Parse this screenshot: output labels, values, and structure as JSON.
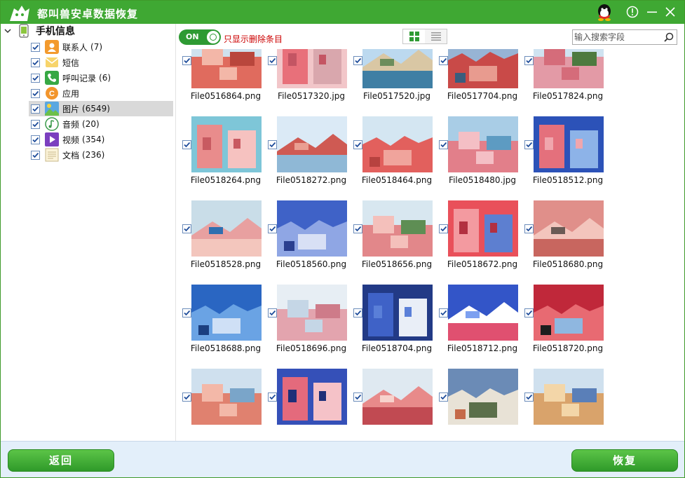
{
  "app": {
    "title": "都叫兽安卓数据恢复",
    "brand_color": "#3fa833"
  },
  "sidebar": {
    "root_label": "手机信息",
    "categories": [
      {
        "name": "联系人",
        "count": "(7)",
        "icon": "contacts-icon",
        "checked": true,
        "selected": false
      },
      {
        "name": "短信",
        "count": "",
        "icon": "sms-icon",
        "checked": true,
        "selected": false
      },
      {
        "name": "呼叫记录",
        "count": "(6)",
        "icon": "call-log-icon",
        "checked": true,
        "selected": false
      },
      {
        "name": "应用",
        "count": "",
        "icon": "apps-icon",
        "checked": true,
        "selected": false
      },
      {
        "name": "图片",
        "count": "(6549)",
        "icon": "photos-icon",
        "checked": true,
        "selected": true
      },
      {
        "name": "音频",
        "count": "(20)",
        "icon": "audio-icon",
        "checked": true,
        "selected": false
      },
      {
        "name": "视频",
        "count": "(354)",
        "icon": "video-icon",
        "checked": true,
        "selected": false
      },
      {
        "name": "文档",
        "count": "(236)",
        "icon": "documents-icon",
        "checked": true,
        "selected": false
      }
    ]
  },
  "toolbar": {
    "toggle_label": "ON",
    "toggle_state": "on",
    "filter_label": "只显示删除条目",
    "view_mode": "grid",
    "search_placeholder": "输入搜索字段"
  },
  "files": [
    {
      "name": "File0516864.png",
      "checked": true,
      "palette": [
        "#cfe1ee",
        "#e06b5e",
        "#f3b7a8",
        "#b9463c"
      ]
    },
    {
      "name": "File0517320.jpg",
      "checked": true,
      "palette": [
        "#f2c6c9",
        "#e8707a",
        "#d9a7ad",
        "#c45563"
      ]
    },
    {
      "name": "File0517520.jpg",
      "checked": true,
      "palette": [
        "#bcd9ef",
        "#d9c7a4",
        "#6d8d5b",
        "#3f7fa4"
      ]
    },
    {
      "name": "File0517704.png",
      "checked": true,
      "palette": [
        "#97b4d4",
        "#c94a48",
        "#e89b8f",
        "#3a5d7d"
      ]
    },
    {
      "name": "File0517824.png",
      "checked": true,
      "palette": [
        "#cfe3f1",
        "#e39aa6",
        "#d56c7a",
        "#4d7a3f"
      ]
    },
    {
      "name": "File0518264.png",
      "checked": true,
      "palette": [
        "#7ec6d8",
        "#e98c8c",
        "#f6c2c0",
        "#c85a61"
      ]
    },
    {
      "name": "File0518272.png",
      "checked": true,
      "palette": [
        "#dbeaf6",
        "#cf5a53",
        "#ea9e92",
        "#8fb8d6"
      ]
    },
    {
      "name": "File0518464.png",
      "checked": true,
      "palette": [
        "#d4e6f2",
        "#e2605d",
        "#f0a49c",
        "#b7423f"
      ]
    },
    {
      "name": "File0518480.jpg",
      "checked": true,
      "palette": [
        "#a9cde6",
        "#e27f8a",
        "#f4bfc5",
        "#5d9bc2"
      ]
    },
    {
      "name": "File0518512.png",
      "checked": true,
      "palette": [
        "#2c52b8",
        "#e4707c",
        "#8db3e8",
        "#f0a6ad"
      ]
    },
    {
      "name": "File0518528.png",
      "checked": true,
      "palette": [
        "#c9dde8",
        "#e8a0a0",
        "#2f6fb0",
        "#f3c6bd"
      ]
    },
    {
      "name": "File0518560.png",
      "checked": true,
      "palette": [
        "#3f62c7",
        "#8fa6e4",
        "#d8e0f5",
        "#2a3f8f"
      ]
    },
    {
      "name": "File0518656.png",
      "checked": true,
      "palette": [
        "#d8e7f0",
        "#e2878a",
        "#f4c0bb",
        "#5e8e54"
      ]
    },
    {
      "name": "File0518672.png",
      "checked": true,
      "palette": [
        "#e9505a",
        "#f39aa0",
        "#5d7fd0",
        "#b23040"
      ]
    },
    {
      "name": "File0518680.png",
      "checked": true,
      "palette": [
        "#e08f8a",
        "#f3c5bd",
        "#6b5a55",
        "#c8665f"
      ]
    },
    {
      "name": "File0518688.png",
      "checked": true,
      "palette": [
        "#2a66c2",
        "#6aa3e4",
        "#cfe0f6",
        "#1b3f80"
      ]
    },
    {
      "name": "File0518696.png",
      "checked": true,
      "palette": [
        "#e7eef4",
        "#e3a4ae",
        "#c5d6e6",
        "#ce7b89"
      ]
    },
    {
      "name": "File0518704.png",
      "checked": true,
      "palette": [
        "#223a86",
        "#3f62c7",
        "#e9eef7",
        "#5a7fd8"
      ]
    },
    {
      "name": "File0518712.png",
      "checked": true,
      "palette": [
        "#3355c8",
        "#ffffff",
        "#7da0f0",
        "#e05070"
      ]
    },
    {
      "name": "File0518720.png",
      "checked": true,
      "palette": [
        "#c0283a",
        "#e86a72",
        "#8fb7e0",
        "#1d1d1d"
      ]
    },
    {
      "name": "",
      "checked": true,
      "palette": [
        "#cfe0ee",
        "#e0816f",
        "#f3b8a8",
        "#7aa5c9"
      ]
    },
    {
      "name": "",
      "checked": true,
      "palette": [
        "#3550b8",
        "#e46a7c",
        "#f5c2c8",
        "#1e2f78"
      ]
    },
    {
      "name": "",
      "checked": true,
      "palette": [
        "#dfe9f1",
        "#e88a8a",
        "#f7d2cc",
        "#c14a52"
      ]
    },
    {
      "name": "",
      "checked": true,
      "palette": [
        "#6b8bb6",
        "#e8e2d6",
        "#5b6f4a",
        "#c56a4a"
      ]
    },
    {
      "name": "",
      "checked": true,
      "palette": [
        "#cfe0ee",
        "#d9a36b",
        "#f3d6a8",
        "#5a7fb8"
      ]
    }
  ],
  "buttons": {
    "back_label": "返回",
    "recover_label": "恢复"
  }
}
